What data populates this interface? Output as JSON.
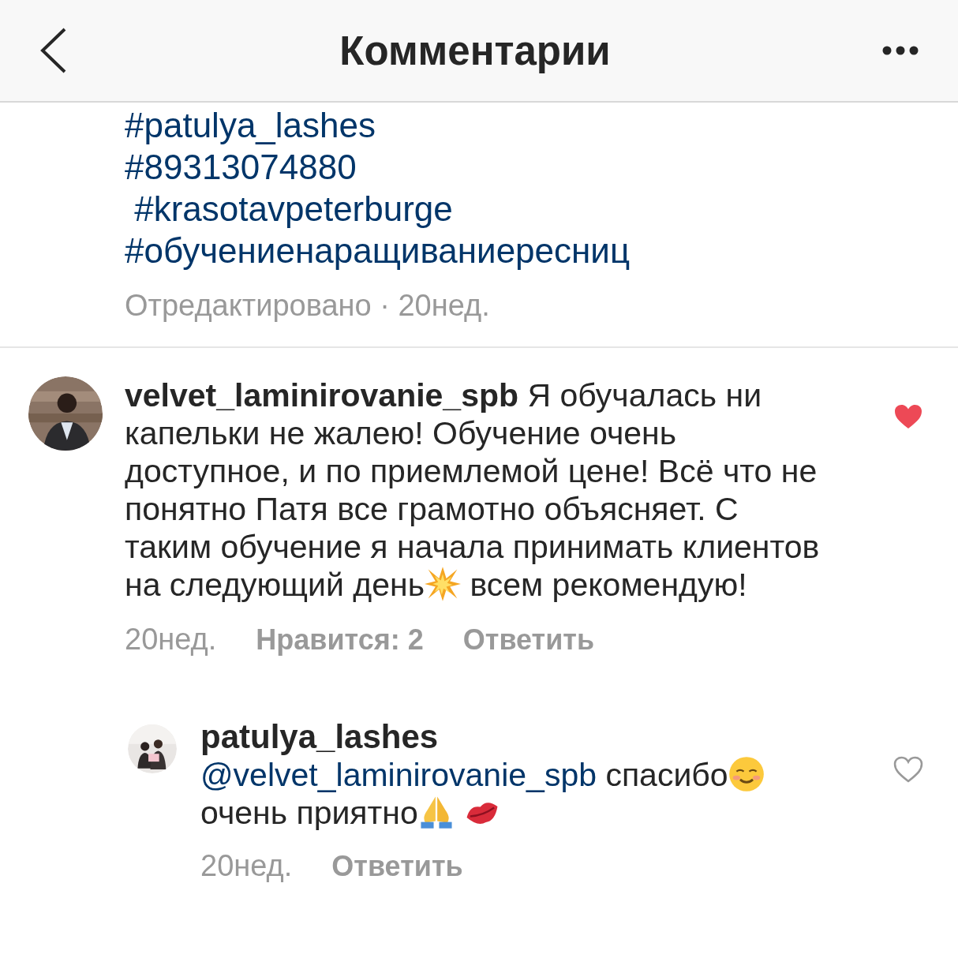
{
  "header": {
    "title": "Комментарии"
  },
  "caption": {
    "hashtags": [
      "#patulya_lashes",
      "#89313074880",
      " #krasotavpeterburge",
      "#обучениенаращиваниересниц"
    ],
    "meta": "Отредактировано · 20нед."
  },
  "comments": [
    {
      "kind": "comment",
      "username": "velvet_laminirovanie_spb",
      "body": [
        {
          "kind": "text",
          "text": " Я обучалась ни капельки не жалею! Обучение очень доступное, и по приемлемой цене! Всё что не понятно Патя все грамотно объясняет. С таким обучение я начала принимать клиентов на следующий день"
        },
        {
          "kind": "burst"
        },
        {
          "kind": "text",
          "text": " всем рекомендую!"
        }
      ],
      "time": "20нед.",
      "likes": "Нравится: 2",
      "reply": "Ответить",
      "liked": true
    },
    {
      "kind": "reply",
      "username": "patulya_lashes",
      "body": [
        {
          "kind": "mention",
          "text": "@velvet_laminirovanie_spb"
        },
        {
          "kind": "text",
          "text": " спасибо"
        },
        {
          "kind": "smile"
        },
        {
          "kind": "text",
          "text": " очень приятно"
        },
        {
          "kind": "pray"
        },
        {
          "kind": "lips"
        }
      ],
      "time": "20нед.",
      "reply": "Ответить",
      "liked": false
    }
  ]
}
